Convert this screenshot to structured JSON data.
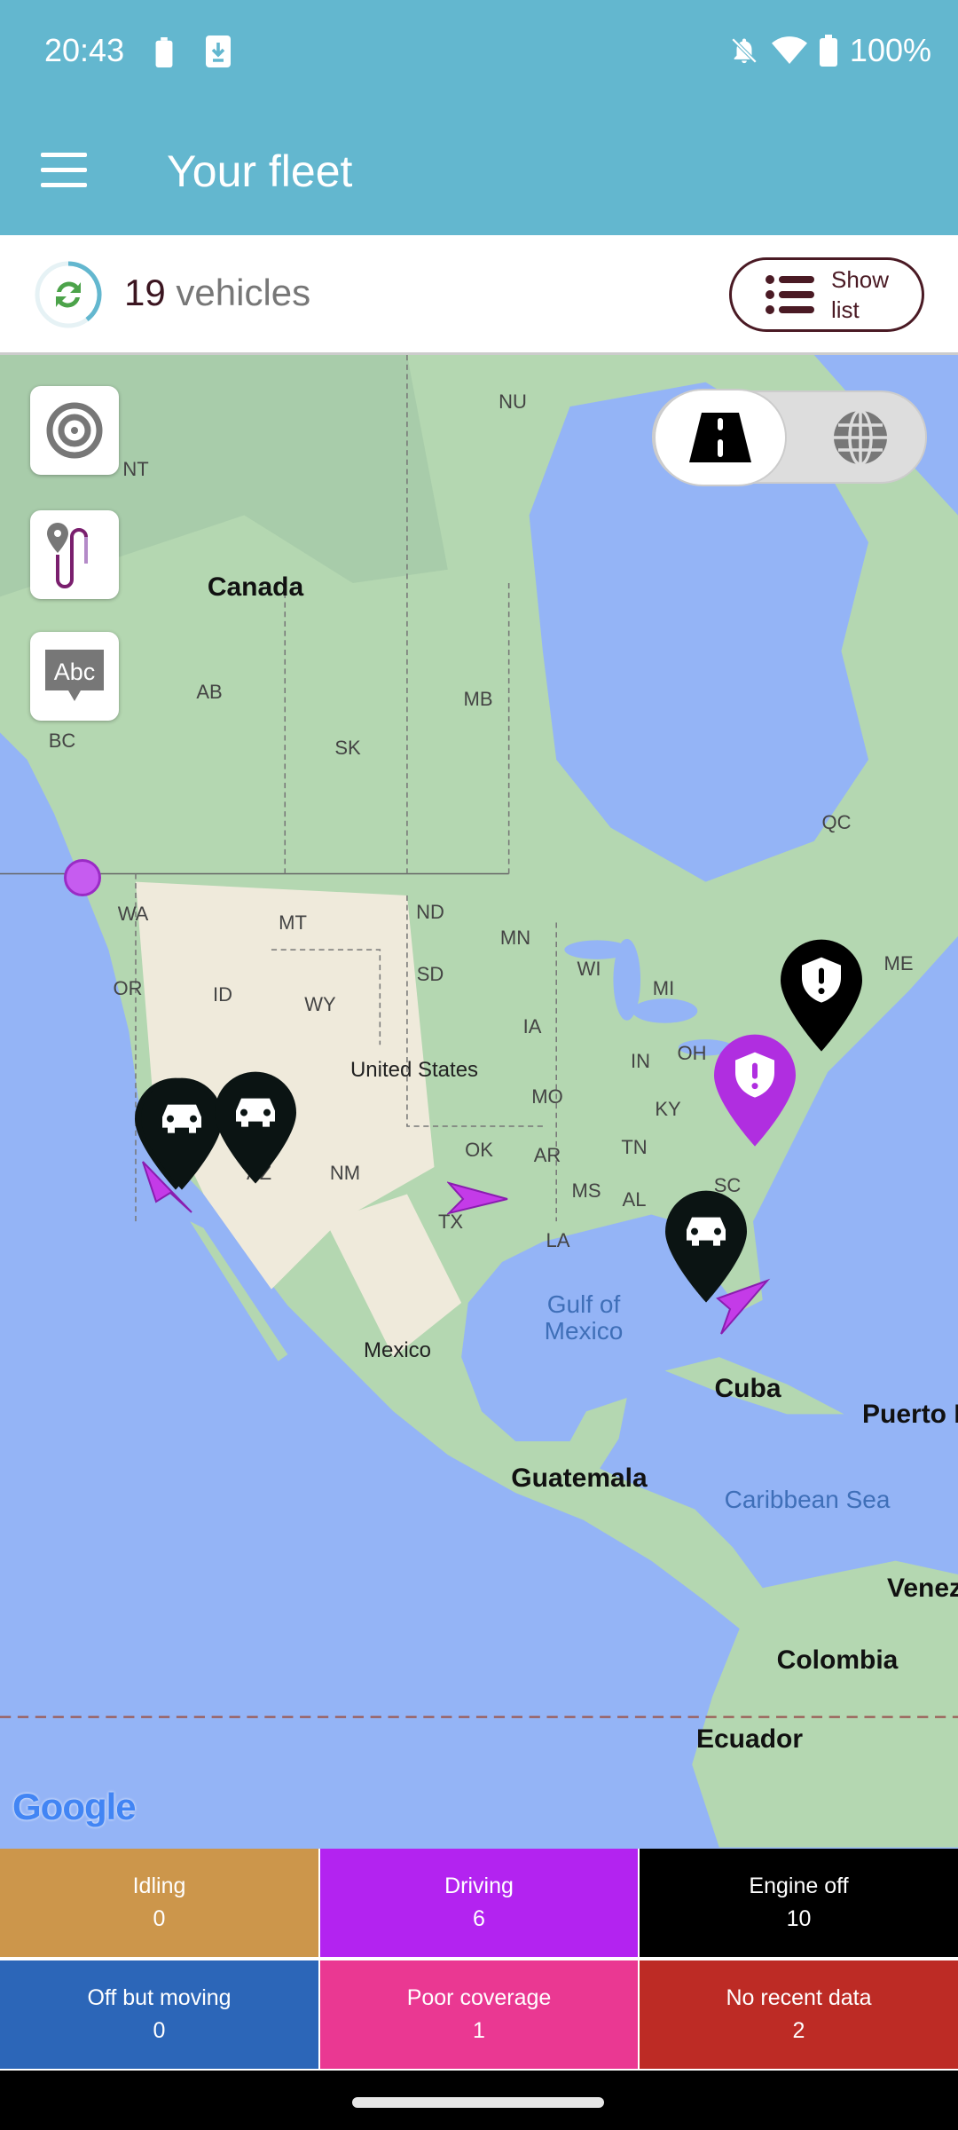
{
  "status_bar": {
    "time": "20:43",
    "battery": "100%",
    "icons": [
      "battery-icon",
      "download-icon",
      "bell-off-icon",
      "wifi-icon",
      "battery-icon"
    ]
  },
  "header": {
    "title": "Your fleet",
    "menu_icon": "hamburger-menu-icon"
  },
  "summary": {
    "count": "19",
    "count_label": "vehicles",
    "show_list_line1": "Show",
    "show_list_line2": "list"
  },
  "map": {
    "controls": {
      "locate": "target-icon",
      "route": "route-icon",
      "labels": "Abc",
      "toggle_selected": "road",
      "toggle_other": "globe"
    },
    "labels": {
      "nu": "NU",
      "nt": "NT",
      "canada": "Canada",
      "ab": "AB",
      "mb": "MB",
      "bc": "BC",
      "sk": "SK",
      "qc": "QC",
      "wa": "WA",
      "mt": "MT",
      "nd": "ND",
      "mn": "MN",
      "wi": "WI",
      "mi": "MI",
      "me": "ME",
      "or": "OR",
      "id": "ID",
      "sd": "SD",
      "wy": "WY",
      "ia": "IA",
      "in": "IN",
      "oh": "OH",
      "us": "United States",
      "ky": "KY",
      "mo": "MO",
      "ok": "OK",
      "ar": "AR",
      "tn": "TN",
      "nm": "NM",
      "ms": "MS",
      "al": "AL",
      "sc": "SC",
      "tx": "TX",
      "la": "LA",
      "az": "AZ",
      "gulf1": "Gulf of",
      "gulf2": "Mexico",
      "mexico": "Mexico",
      "cuba": "Cuba",
      "pr": "Puerto R",
      "guatemala": "Guatemala",
      "caribbean": "Caribbean Sea",
      "venez": "Venez",
      "colombia": "Colombia",
      "ecuador": "Ecuador"
    },
    "attribution": "Google"
  },
  "statuses": [
    {
      "label": "Idling",
      "value": "0",
      "color": "#cc964b"
    },
    {
      "label": "Driving",
      "value": "6",
      "color": "#b323f0"
    },
    {
      "label": "Engine off",
      "value": "10",
      "color": "#000000"
    },
    {
      "label": "Off but moving",
      "value": "0",
      "color": "#2c66b8"
    },
    {
      "label": "Poor coverage",
      "value": "1",
      "color": "#ea3892"
    },
    {
      "label": "No recent data",
      "value": "2",
      "color": "#bd2b25"
    }
  ]
}
